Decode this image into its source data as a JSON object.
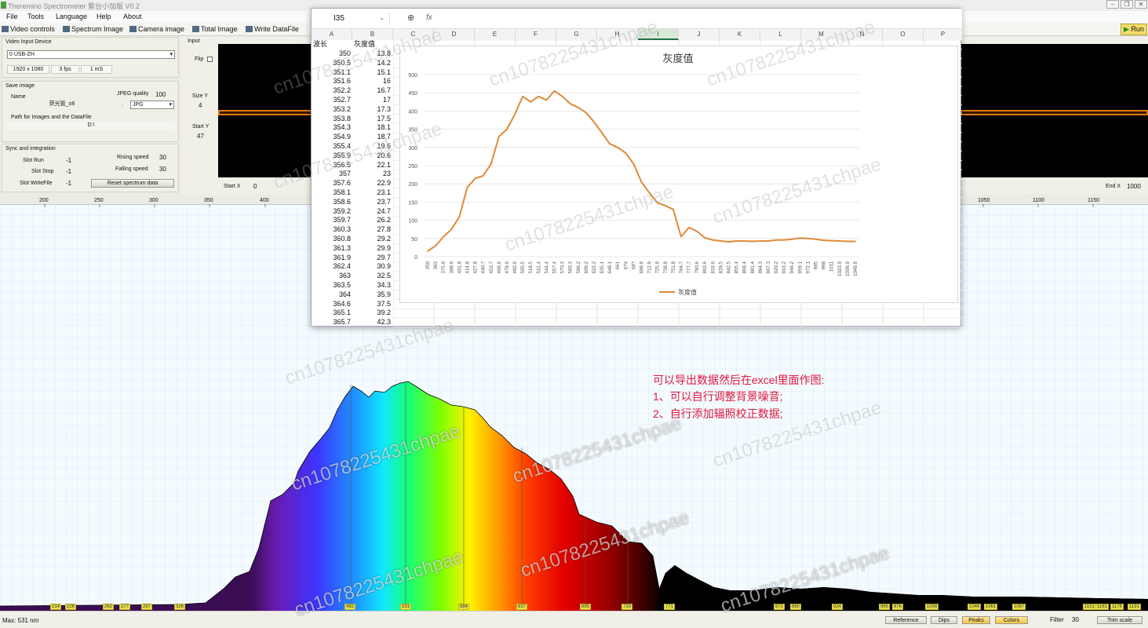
{
  "window": {
    "title": "Theremino Spectrometer 紫台小加版 V0.2"
  },
  "menu": [
    "File",
    "Tools",
    "Language",
    "Help",
    "About"
  ],
  "toolbar": {
    "video_controls": "Video controls",
    "spectrum_image": "Spectrum Image",
    "camera_image": "Camera image",
    "total_image": "Total Image",
    "write_datafile": "Write DataFile",
    "run": "Run"
  },
  "video": {
    "title": "Video Input Device",
    "device": "0 USB-ZH",
    "resolution": "1920 x 1080",
    "fps": "3 fps",
    "exposure": "1 mS"
  },
  "save": {
    "title": "Save image",
    "name_label": "Name",
    "name_value": "荧光管_o6",
    "sep": ".",
    "jpeg_label": "JPEG quality",
    "jpeg_value": "100",
    "format": "JPG",
    "path_label": "Path for Images and the DataFile",
    "path_value": "D:\\"
  },
  "sync": {
    "title": "Sync and integration",
    "slot_run_label": "Slot Run",
    "slot_run": "-1",
    "slot_stop_label": "Slot Stop",
    "slot_stop": "-1",
    "slot_writefile_label": "Slot WriteFile",
    "slot_writefile": "-1",
    "rising_label": "Rising speed",
    "rising": "30",
    "falling_label": "Falling speed",
    "falling": "30",
    "reset": "Reset spectrum data"
  },
  "input": {
    "title": "Input",
    "flip": "Flip",
    "size_y_label": "Size Y",
    "size_y": "4",
    "start_y_label": "Start Y",
    "start_y": "47",
    "start_x_label": "Start X",
    "start_x": "0",
    "end_x_label": "End X",
    "end_x": "1000"
  },
  "axis_ticks": [
    "200",
    "250",
    "300",
    "350",
    "400",
    "1050",
    "1100",
    "1150"
  ],
  "peaks": [
    "214",
    "226",
    "262",
    "277",
    "297",
    "326",
    "482",
    "531",
    "584",
    "637",
    "695",
    "733",
    "771",
    "872",
    "885",
    "924",
    "965",
    "976",
    "1008",
    "1046",
    "1061",
    "1087",
    "1151",
    "1161",
    "1176",
    "1191"
  ],
  "annotation": {
    "line1": "可以导出数据然后在excel里面作图:",
    "line2": "1、可以自行调整背景噪音;",
    "line3": "2、自行添加辐照校正数据;"
  },
  "watermark": "cn1078225431chpae",
  "status": {
    "max": "Max: 531 nm",
    "reference": "Reference",
    "dips": "Dips",
    "peaks": "Peaks",
    "colors": "Colors",
    "filter_label": "Filter",
    "filter": "30",
    "trim": "Trim scale"
  },
  "excel": {
    "namebox": "I35",
    "zoom_icon": "zoom-icon",
    "fx": "fx",
    "columns": [
      "A",
      "B",
      "C",
      "D",
      "E",
      "F",
      "G",
      "H",
      "I",
      "J",
      "K",
      "L",
      "M",
      "N",
      "O",
      "P"
    ],
    "header_a": "波长",
    "header_b": "灰度值",
    "rows": [
      [
        "350",
        "13.8"
      ],
      [
        "350.5",
        "14.2"
      ],
      [
        "351.1",
        "15.1"
      ],
      [
        "351.6",
        "16"
      ],
      [
        "352.2",
        "16.7"
      ],
      [
        "352.7",
        "17"
      ],
      [
        "353.2",
        "17.3"
      ],
      [
        "353.8",
        "17.5"
      ],
      [
        "354.3",
        "18.1"
      ],
      [
        "354.9",
        "18.7"
      ],
      [
        "355.4",
        "19.6"
      ],
      [
        "355.9",
        "20.6"
      ],
      [
        "356.5",
        "22.1"
      ],
      [
        "357",
        "23"
      ],
      [
        "357.6",
        "22.9"
      ],
      [
        "358.1",
        "23.1"
      ],
      [
        "358.6",
        "23.7"
      ],
      [
        "359.2",
        "24.7"
      ],
      [
        "359.7",
        "26.2"
      ],
      [
        "360.3",
        "27.8"
      ],
      [
        "360.8",
        "29.2"
      ],
      [
        "361.3",
        "29.9"
      ],
      [
        "361.9",
        "29.7"
      ],
      [
        "362.4",
        "30.9"
      ],
      [
        "363",
        "32.5"
      ],
      [
        "363.5",
        "34.3"
      ],
      [
        "364",
        "35.9"
      ],
      [
        "364.6",
        "37.5"
      ],
      [
        "365.1",
        "39.2"
      ],
      [
        "365.7",
        "42.3"
      ]
    ]
  },
  "chart_data": {
    "type": "line",
    "title": "灰度值",
    "legend": "灰度值",
    "legend_position": "bottom",
    "ylim": [
      0,
      500
    ],
    "yticks": [
      0,
      50,
      100,
      150,
      200,
      250,
      300,
      350,
      400,
      450,
      500
    ],
    "grid": true,
    "x": [
      "350",
      "363",
      "375.9",
      "388.9",
      "401.8",
      "414.8",
      "427.8",
      "440.7",
      "453.7",
      "466.6",
      "479.6",
      "492.6",
      "505.5",
      "518.5",
      "531.4",
      "544.4",
      "557.4",
      "570.3",
      "583.3",
      "596.2",
      "609.2",
      "622.2",
      "635.1",
      "648.1",
      "661",
      "674",
      "687",
      "699.9",
      "712.9",
      "725.8",
      "738.8",
      "751.8",
      "764.7",
      "777.7",
      "790.6",
      "803.6",
      "816.6",
      "829.5",
      "842.5",
      "855.4",
      "868.4",
      "881.4",
      "894.3",
      "907.3",
      "920.2",
      "933.2",
      "946.2",
      "959.1",
      "972.1",
      "985",
      "998",
      "1011",
      "1023.9",
      "1036.9",
      "1049.8"
    ],
    "values": [
      15,
      30,
      55,
      75,
      110,
      190,
      215,
      222,
      255,
      330,
      350,
      390,
      440,
      425,
      440,
      430,
      455,
      440,
      420,
      410,
      395,
      370,
      340,
      310,
      300,
      285,
      255,
      205,
      175,
      148,
      140,
      130,
      55,
      80,
      70,
      52,
      46,
      43,
      41,
      43,
      43,
      42,
      43,
      43,
      46,
      46,
      48,
      51,
      50,
      48,
      45,
      44,
      43,
      42,
      42
    ],
    "series_color": "#e08a38"
  }
}
